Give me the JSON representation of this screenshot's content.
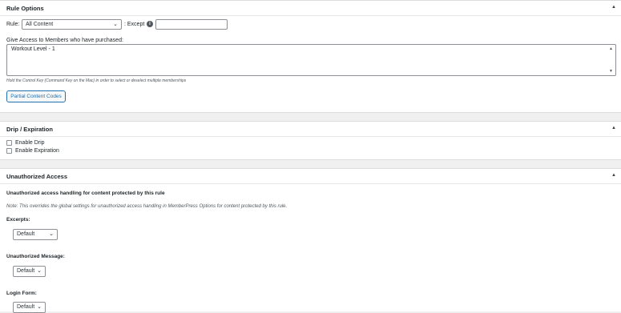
{
  "rule_options": {
    "title": "Rule Options",
    "rule_label": "Rule:",
    "rule_value": "All Content",
    "except_label": ": Except",
    "except_value": "",
    "access_label": "Give Access to Members who have purchased:",
    "memberships": [
      "Workout Level - 1"
    ],
    "hint": "Hold the Control Key (Command Key on the Mac) in order to select or deselect multiple memberships",
    "partial_button": "Partial Content Codes"
  },
  "drip": {
    "title": "Drip / Expiration",
    "enable_drip": "Enable Drip",
    "enable_expiration": "Enable Expiration"
  },
  "unauthorized": {
    "title": "Unauthorized Access",
    "heading": "Unauthorized access handling for content protected by this rule",
    "note": "Note: This overrides the global settings for unauthorized access handling in MemberPress Options for content protected by this rule.",
    "excerpts_label": "Excerpts:",
    "excerpts_value": "Default",
    "message_label": "Unauthorized Message:",
    "message_value": "Default",
    "login_label": "Login Form:",
    "login_value": "Default"
  },
  "icons": {
    "toggle": "triangle-up-icon",
    "info": "info-icon",
    "dropdown": "chevron-down-icon"
  }
}
